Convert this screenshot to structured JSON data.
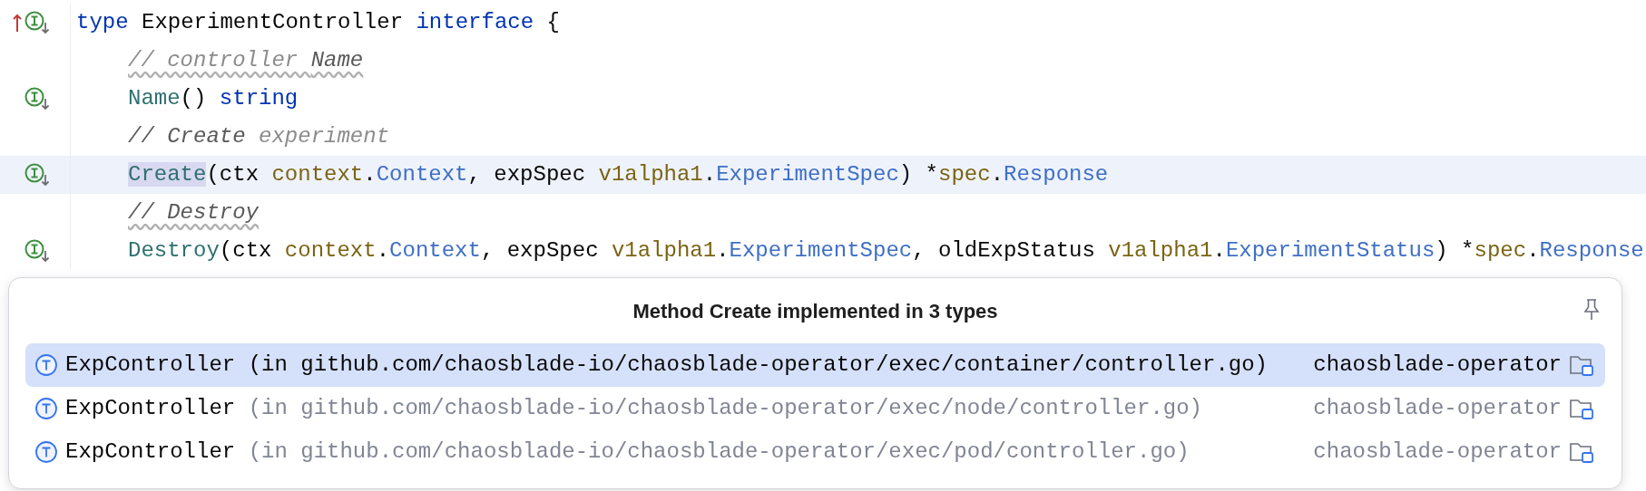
{
  "editor": {
    "lines": [
      {
        "gutter": {
          "kind": "overridden_implemented"
        },
        "indented": false,
        "current": false,
        "typo_underline": false,
        "tokens": [
          {
            "text": "type",
            "kind": "keyword"
          },
          {
            "text": " ExperimentController ",
            "kind": "plain"
          },
          {
            "text": "interface",
            "kind": "keyword"
          },
          {
            "text": " {",
            "kind": "plain"
          }
        ]
      },
      {
        "indented": true,
        "current": false,
        "typo_underline": true,
        "tokens": [
          {
            "text": "// controller ",
            "kind": "comment"
          },
          {
            "text": "Name",
            "kind": "comment_dark"
          }
        ]
      },
      {
        "gutter": {
          "kind": "implemented"
        },
        "indented": true,
        "current": false,
        "typo_underline": false,
        "tokens": [
          {
            "text": "Name",
            "kind": "method"
          },
          {
            "text": "() ",
            "kind": "plain"
          },
          {
            "text": "string",
            "kind": "keyword"
          }
        ]
      },
      {
        "indented": true,
        "current": false,
        "typo_underline": false,
        "tokens": [
          {
            "text": "// Create",
            "kind": "comment_dark"
          },
          {
            "text": " experiment",
            "kind": "comment"
          }
        ]
      },
      {
        "gutter": {
          "kind": "implemented"
        },
        "indented": true,
        "current": true,
        "typo_underline": false,
        "tokens": [
          {
            "text": "Create",
            "kind": "method",
            "highlight": true
          },
          {
            "text": "(ctx ",
            "kind": "plain"
          },
          {
            "text": "context",
            "kind": "package"
          },
          {
            "text": ".",
            "kind": "plain"
          },
          {
            "text": "Context",
            "kind": "type"
          },
          {
            "text": ", expSpec ",
            "kind": "plain"
          },
          {
            "text": "v1alpha1",
            "kind": "package"
          },
          {
            "text": ".",
            "kind": "plain"
          },
          {
            "text": "ExperimentSpec",
            "kind": "type"
          },
          {
            "text": ") *",
            "kind": "plain"
          },
          {
            "text": "spec",
            "kind": "package"
          },
          {
            "text": ".",
            "kind": "plain"
          },
          {
            "text": "Response",
            "kind": "type"
          }
        ]
      },
      {
        "indented": true,
        "current": false,
        "typo_underline": true,
        "tokens": [
          {
            "text": "// Destroy",
            "kind": "comment_dark"
          }
        ]
      },
      {
        "gutter": {
          "kind": "implemented"
        },
        "indented": true,
        "current": false,
        "typo_underline": false,
        "tokens": [
          {
            "text": "Destroy",
            "kind": "method"
          },
          {
            "text": "(ctx ",
            "kind": "plain"
          },
          {
            "text": "context",
            "kind": "package"
          },
          {
            "text": ".",
            "kind": "plain"
          },
          {
            "text": "Context",
            "kind": "type"
          },
          {
            "text": ", expSpec ",
            "kind": "plain"
          },
          {
            "text": "v1alpha1",
            "kind": "package"
          },
          {
            "text": ".",
            "kind": "plain"
          },
          {
            "text": "ExperimentSpec",
            "kind": "type"
          },
          {
            "text": ", oldExpStatus ",
            "kind": "plain"
          },
          {
            "text": "v1alpha1",
            "kind": "package"
          },
          {
            "text": ".",
            "kind": "plain"
          },
          {
            "text": "ExperimentStatus",
            "kind": "type"
          },
          {
            "text": ") *",
            "kind": "plain"
          },
          {
            "text": "spec",
            "kind": "package"
          },
          {
            "text": ".",
            "kind": "plain"
          },
          {
            "text": "Response",
            "kind": "type"
          }
        ]
      }
    ]
  },
  "popup": {
    "title": "Method Create implemented in 3 types",
    "pinned": false,
    "rows": [
      {
        "name": "ExpController",
        "location": "(in github.com/chaosblade-io/chaosblade-operator/exec/container/controller.go)",
        "module": "chaosblade-operator",
        "selected": true
      },
      {
        "name": "ExpController",
        "location": "(in github.com/chaosblade-io/chaosblade-operator/exec/node/controller.go)",
        "module": "chaosblade-operator",
        "selected": false
      },
      {
        "name": "ExpController",
        "location": "(in github.com/chaosblade-io/chaosblade-operator/exec/pod/controller.go)",
        "module": "chaosblade-operator",
        "selected": false
      }
    ]
  }
}
